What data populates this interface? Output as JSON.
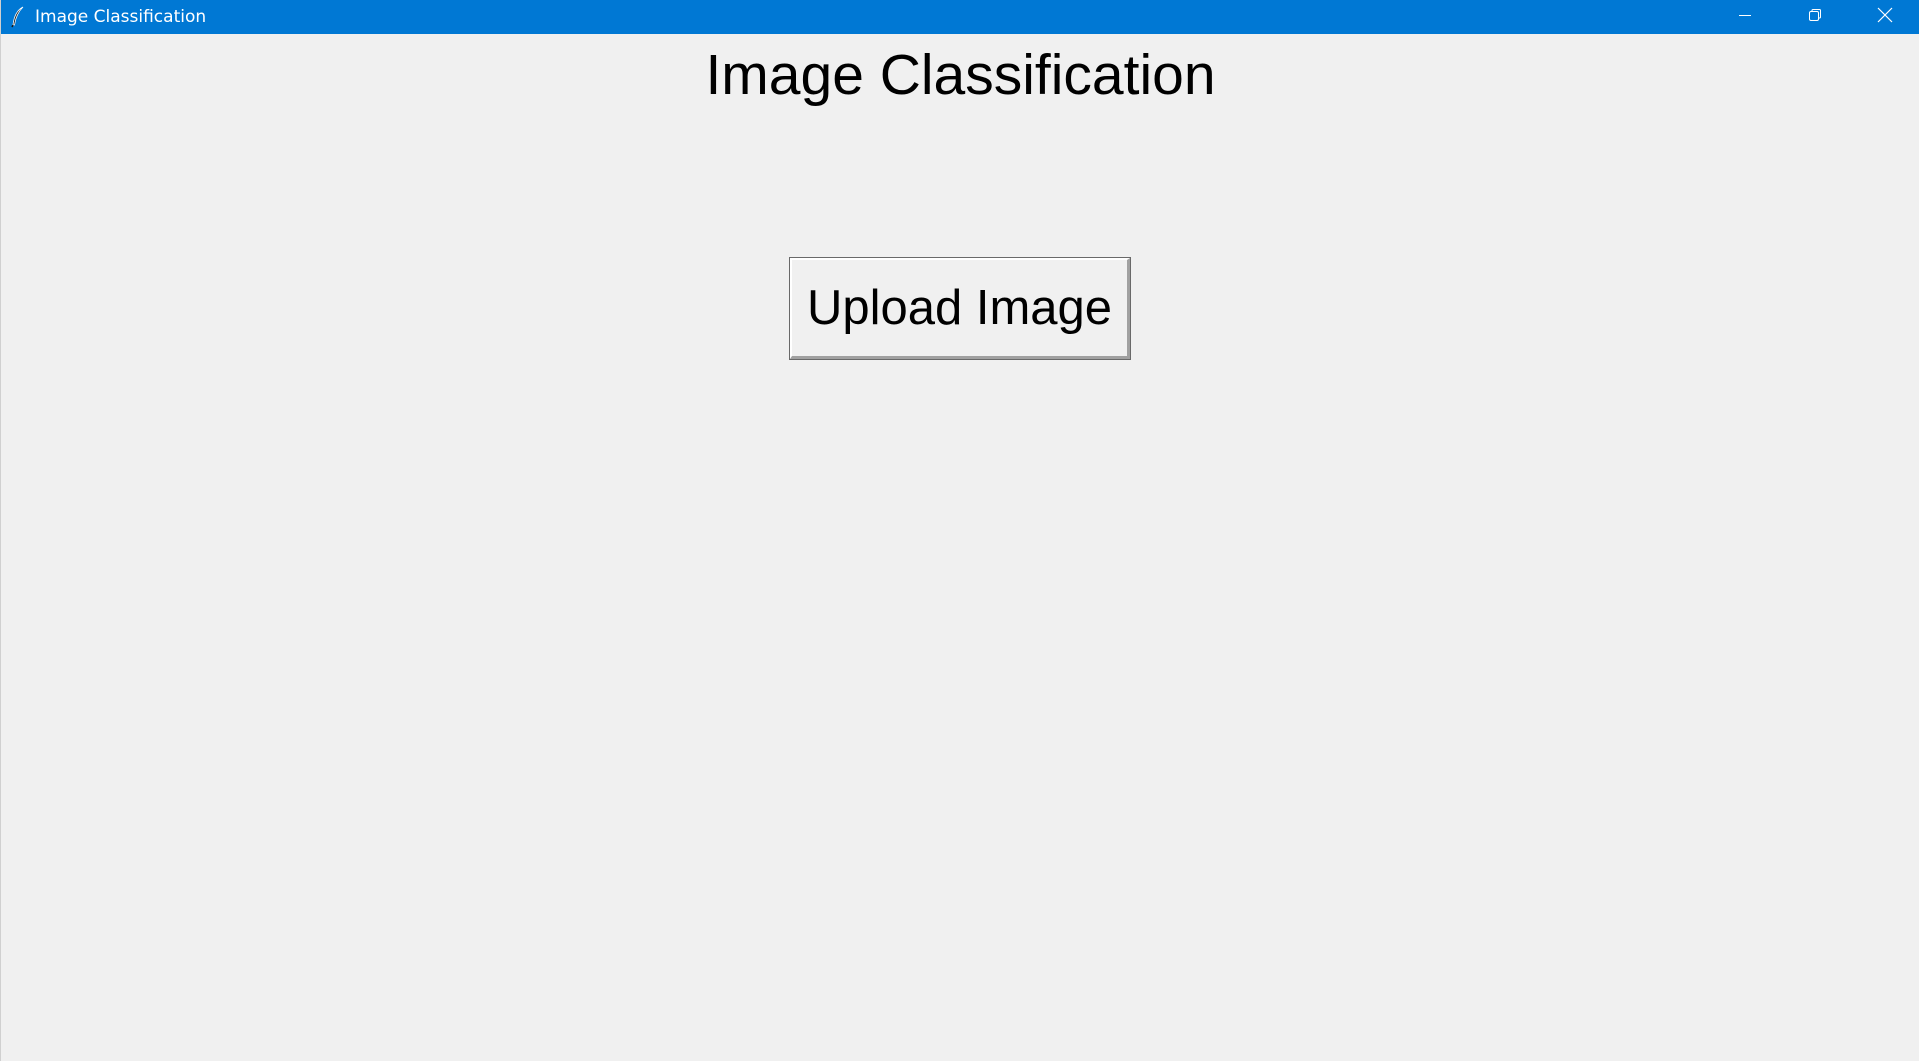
{
  "window": {
    "title": "Image Classification",
    "accent_color": "#0078d4",
    "app_icon": "feather-icon",
    "controls": {
      "minimize_icon": "minimize-icon",
      "restore_icon": "restore-icon",
      "close_icon": "close-icon"
    }
  },
  "main": {
    "heading": "Image Classification",
    "upload_button_label": "Upload Image"
  }
}
